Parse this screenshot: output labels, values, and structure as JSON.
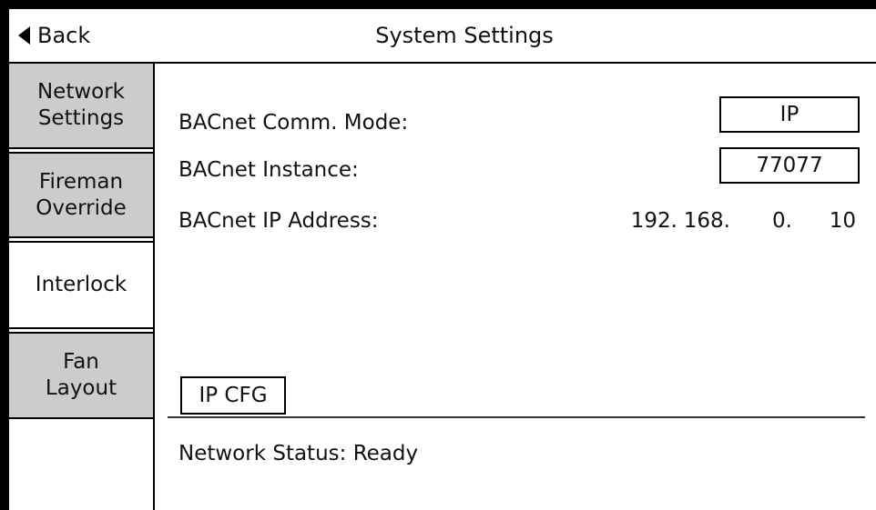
{
  "header": {
    "back_label": "Back",
    "title": "System Settings"
  },
  "sidebar": {
    "tabs": [
      {
        "label": "Network\nSettings",
        "active": false
      },
      {
        "label": "Fireman\nOverride",
        "active": false
      },
      {
        "label": "Interlock",
        "active": true
      },
      {
        "label": "Fan\nLayout",
        "active": false
      }
    ]
  },
  "settings": {
    "comm_mode_label": "BACnet Comm. Mode:",
    "comm_mode_value": "IP",
    "instance_label": "BACnet Instance:",
    "instance_value": "77077",
    "ip_label": "BACnet IP Address:",
    "ip_octets": [
      "192.",
      "168.",
      "0.",
      "10"
    ]
  },
  "actions": {
    "ipcfg_label": "IP CFG"
  },
  "status": {
    "text": "Network Status: Ready"
  },
  "colors": {
    "inactive_tab": "#cccccc",
    "frame": "#000000",
    "background": "#ffffff"
  }
}
